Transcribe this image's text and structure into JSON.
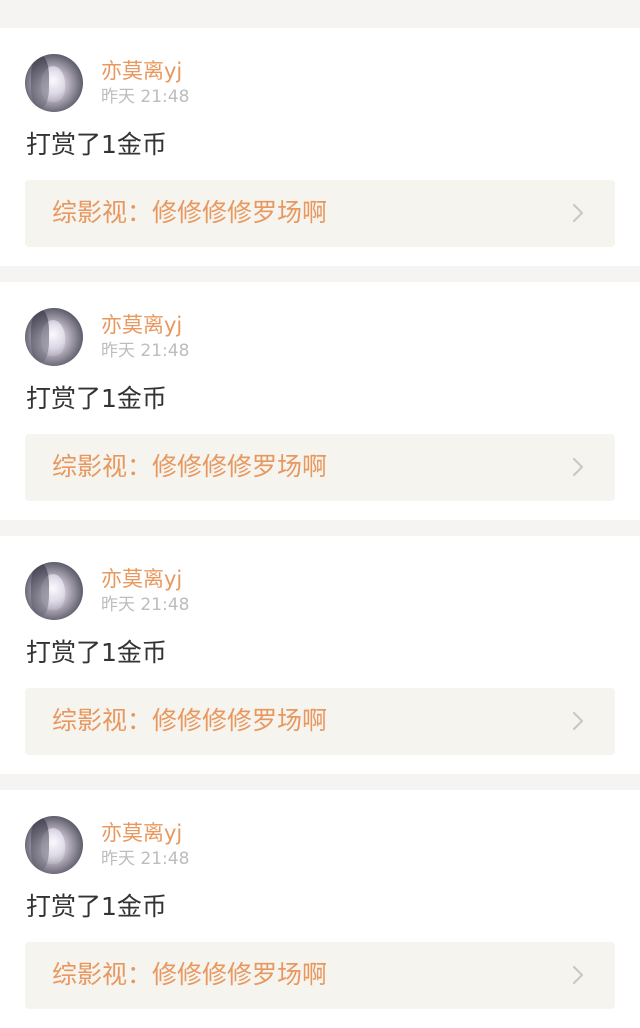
{
  "notifications": [
    {
      "username": "亦莫离yj",
      "timestamp": "昨天 21:48",
      "action": "打赏了1金币",
      "link": "综影视：修修修修罗场啊"
    },
    {
      "username": "亦莫离yj",
      "timestamp": "昨天 21:48",
      "action": "打赏了1金币",
      "link": "综影视：修修修修罗场啊"
    },
    {
      "username": "亦莫离yj",
      "timestamp": "昨天 21:48",
      "action": "打赏了1金币",
      "link": "综影视：修修修修罗场啊"
    },
    {
      "username": "亦莫离yj",
      "timestamp": "昨天 21:48",
      "action": "打赏了1金币",
      "link": "综影视：修修修修罗场啊"
    }
  ],
  "icons": {
    "chevron": "chevron-right-icon",
    "avatar": "avatar"
  },
  "colors": {
    "accent": "#e8985f",
    "timestamp": "#bdbdbd",
    "text": "#333333",
    "link_bg": "#f5f4ee",
    "page_bg": "#f5f4f2"
  }
}
